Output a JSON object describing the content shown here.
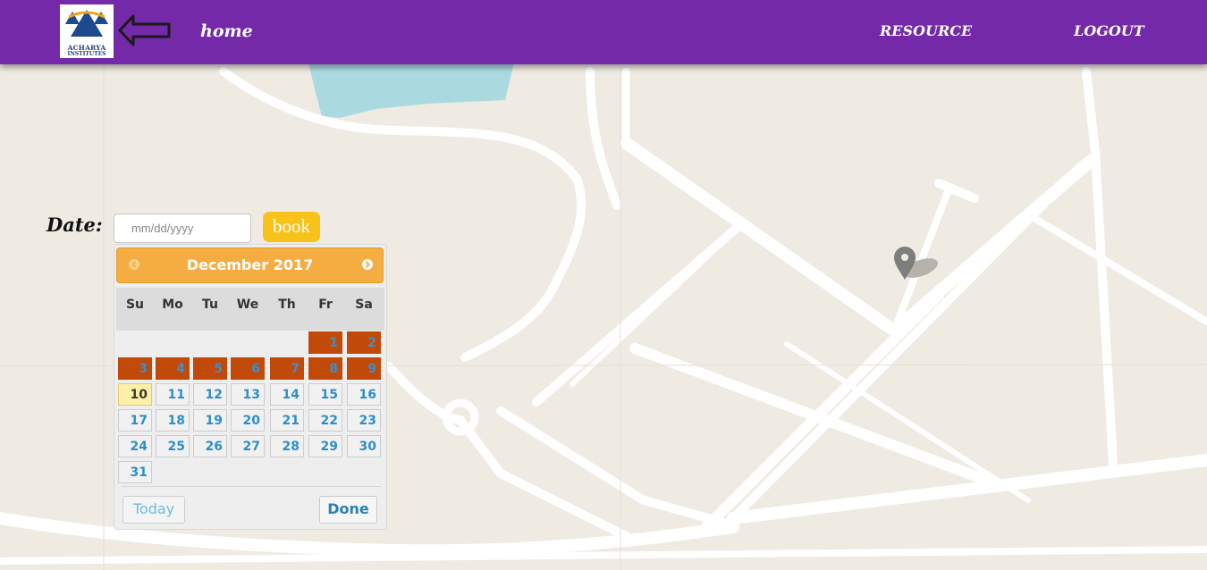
{
  "nav": {
    "logo": {
      "line1": "ACHARYA",
      "line2": "INSTITUTES"
    },
    "home": "home",
    "resource": "RESOURCE",
    "logout": "LOGOUT",
    "colors": {
      "bar": "#7329a8",
      "text": "#ffffff"
    }
  },
  "form": {
    "date_label": "Date:",
    "date_placeholder": "mm/dd/yyyy",
    "date_value": "",
    "book_label": "book"
  },
  "datepicker": {
    "month_title": "December 2017",
    "weekdays": [
      "Su",
      "Mo",
      "Tu",
      "We",
      "Th",
      "Fr",
      "Sa"
    ],
    "weeks": [
      [
        null,
        null,
        null,
        null,
        null,
        1,
        2
      ],
      [
        3,
        4,
        5,
        6,
        7,
        8,
        9
      ],
      [
        10,
        11,
        12,
        13,
        14,
        15,
        16
      ],
      [
        17,
        18,
        19,
        20,
        21,
        22,
        23
      ],
      [
        24,
        25,
        26,
        27,
        28,
        29,
        30
      ],
      [
        31,
        null,
        null,
        null,
        null,
        null,
        null
      ]
    ],
    "blocked_days": [
      1,
      2,
      3,
      4,
      5,
      6,
      7,
      8,
      9
    ],
    "today_day": 10,
    "today_button": "Today",
    "done_button": "Done",
    "icons": {
      "prev": "chevron-left-icon",
      "next": "chevron-right-icon"
    },
    "colors": {
      "header": "#f5ad42",
      "blocked": "#c24a08",
      "today": "#fdf0a8",
      "day_text": "#2e8ec9"
    }
  },
  "map": {
    "icons": {
      "marker": "map-pin-icon"
    },
    "colors": {
      "land": "#efebe3",
      "road": "#ffffff",
      "water": "#aadae0"
    }
  }
}
